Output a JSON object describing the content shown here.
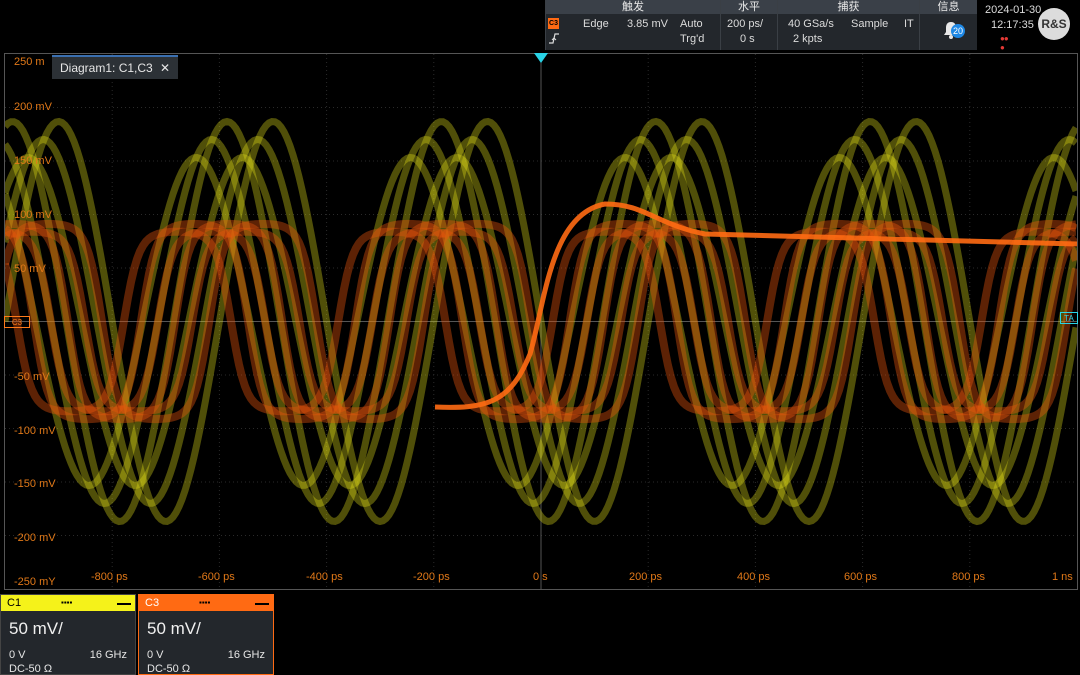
{
  "header": {
    "trigger": {
      "title": "触发",
      "badge": "C3",
      "type": "Edge",
      "level": "3.85 mV",
      "mode": "Auto",
      "status": "Trg'd"
    },
    "horizontal": {
      "title": "水平",
      "scale": "200 ps/",
      "position": "0 s"
    },
    "acquisition": {
      "title": "捕获",
      "rate": "40 GSa/s",
      "mode": "Sample",
      "extra": "IT",
      "points": "2 kpts"
    },
    "info": {
      "title": "信息",
      "count": "20"
    },
    "datetime": {
      "date": "2024-01-30",
      "time": "12:17:35"
    },
    "logo": "R&S"
  },
  "diagram": {
    "tab_label": "Diagram1: C1,C3",
    "close_label": "✕",
    "y_labels": [
      "250 m",
      "200 mV",
      "150 mV",
      "100 mV",
      "50 mV",
      "-50 mV",
      "-100 mV",
      "-150 mV",
      "-200 mV",
      "-250 mY"
    ],
    "x_labels": [
      "-800 ps",
      "-600 ps",
      "-400 ps",
      "-200 ps",
      "0 s",
      "200 ps",
      "400 ps",
      "600 ps",
      "800 ps",
      "1 ns"
    ],
    "c3_marker": "C3",
    "ta_marker": "TA"
  },
  "channels": [
    {
      "name": "C1",
      "scale": "50 mV/",
      "offset": "0 V",
      "bandwidth": "16 GHz",
      "coupling": "DC-50 Ω",
      "color": "#f5f21a"
    },
    {
      "name": "C3",
      "scale": "50 mV/",
      "offset": "0 V",
      "bandwidth": "16 GHz",
      "coupling": "DC-50 Ω",
      "color": "#ff6a13"
    }
  ],
  "colors": {
    "c1": "#e6e21a",
    "c3": "#e8560c",
    "trigger": "#29d3e6",
    "label": "#e07818"
  }
}
